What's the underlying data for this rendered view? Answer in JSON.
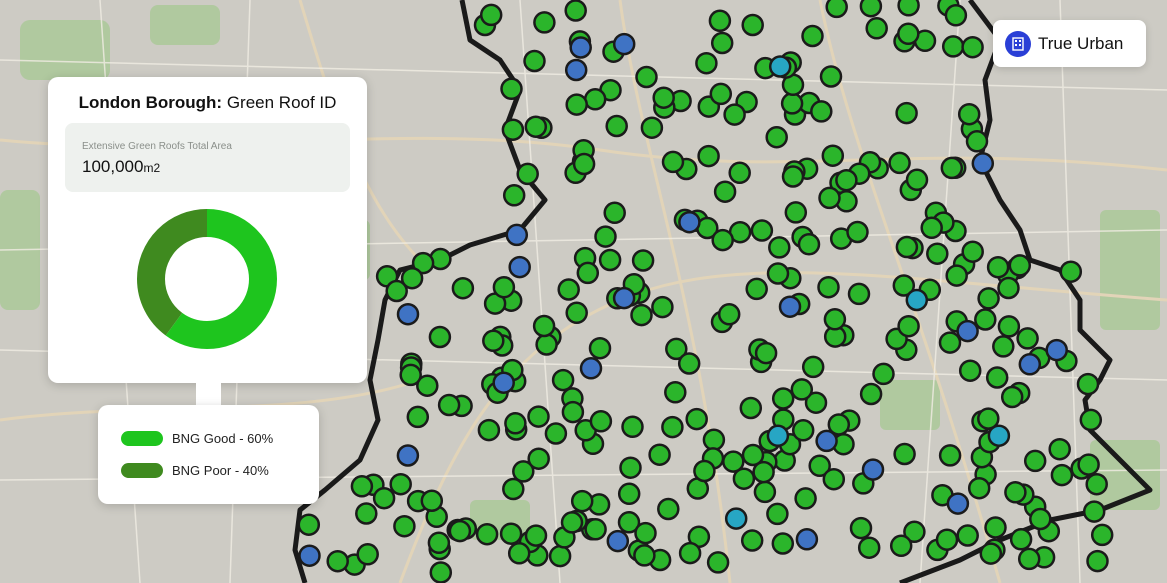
{
  "info_card": {
    "title_bold": "London Borough:",
    "title_rest": " Green Roof ID",
    "area_label": "Extensive Green Roofs Total Area",
    "area_value": "100,000",
    "area_unit": "m2"
  },
  "donut": {
    "slices": [
      {
        "label": "BNG Good",
        "value": 60,
        "color": "#1ec51e"
      },
      {
        "label": "BNG Poor",
        "value": 40,
        "color": "#3f8a1f"
      }
    ]
  },
  "legend": {
    "good_label": "BNG Good - 60%",
    "poor_label": "BNG Poor - 40%",
    "good_color": "#1ec51e",
    "poor_color": "#3f8a1f"
  },
  "brand": {
    "name": "True Urban",
    "icon": "building-icon",
    "color": "#2a3fd6"
  },
  "map": {
    "marker_colors": {
      "green": "#2bb52b",
      "blue": "#3f73c4",
      "cyan": "#27a6c4"
    },
    "marker_counts": {
      "green": 320,
      "blue": 22,
      "cyan": 5
    }
  }
}
